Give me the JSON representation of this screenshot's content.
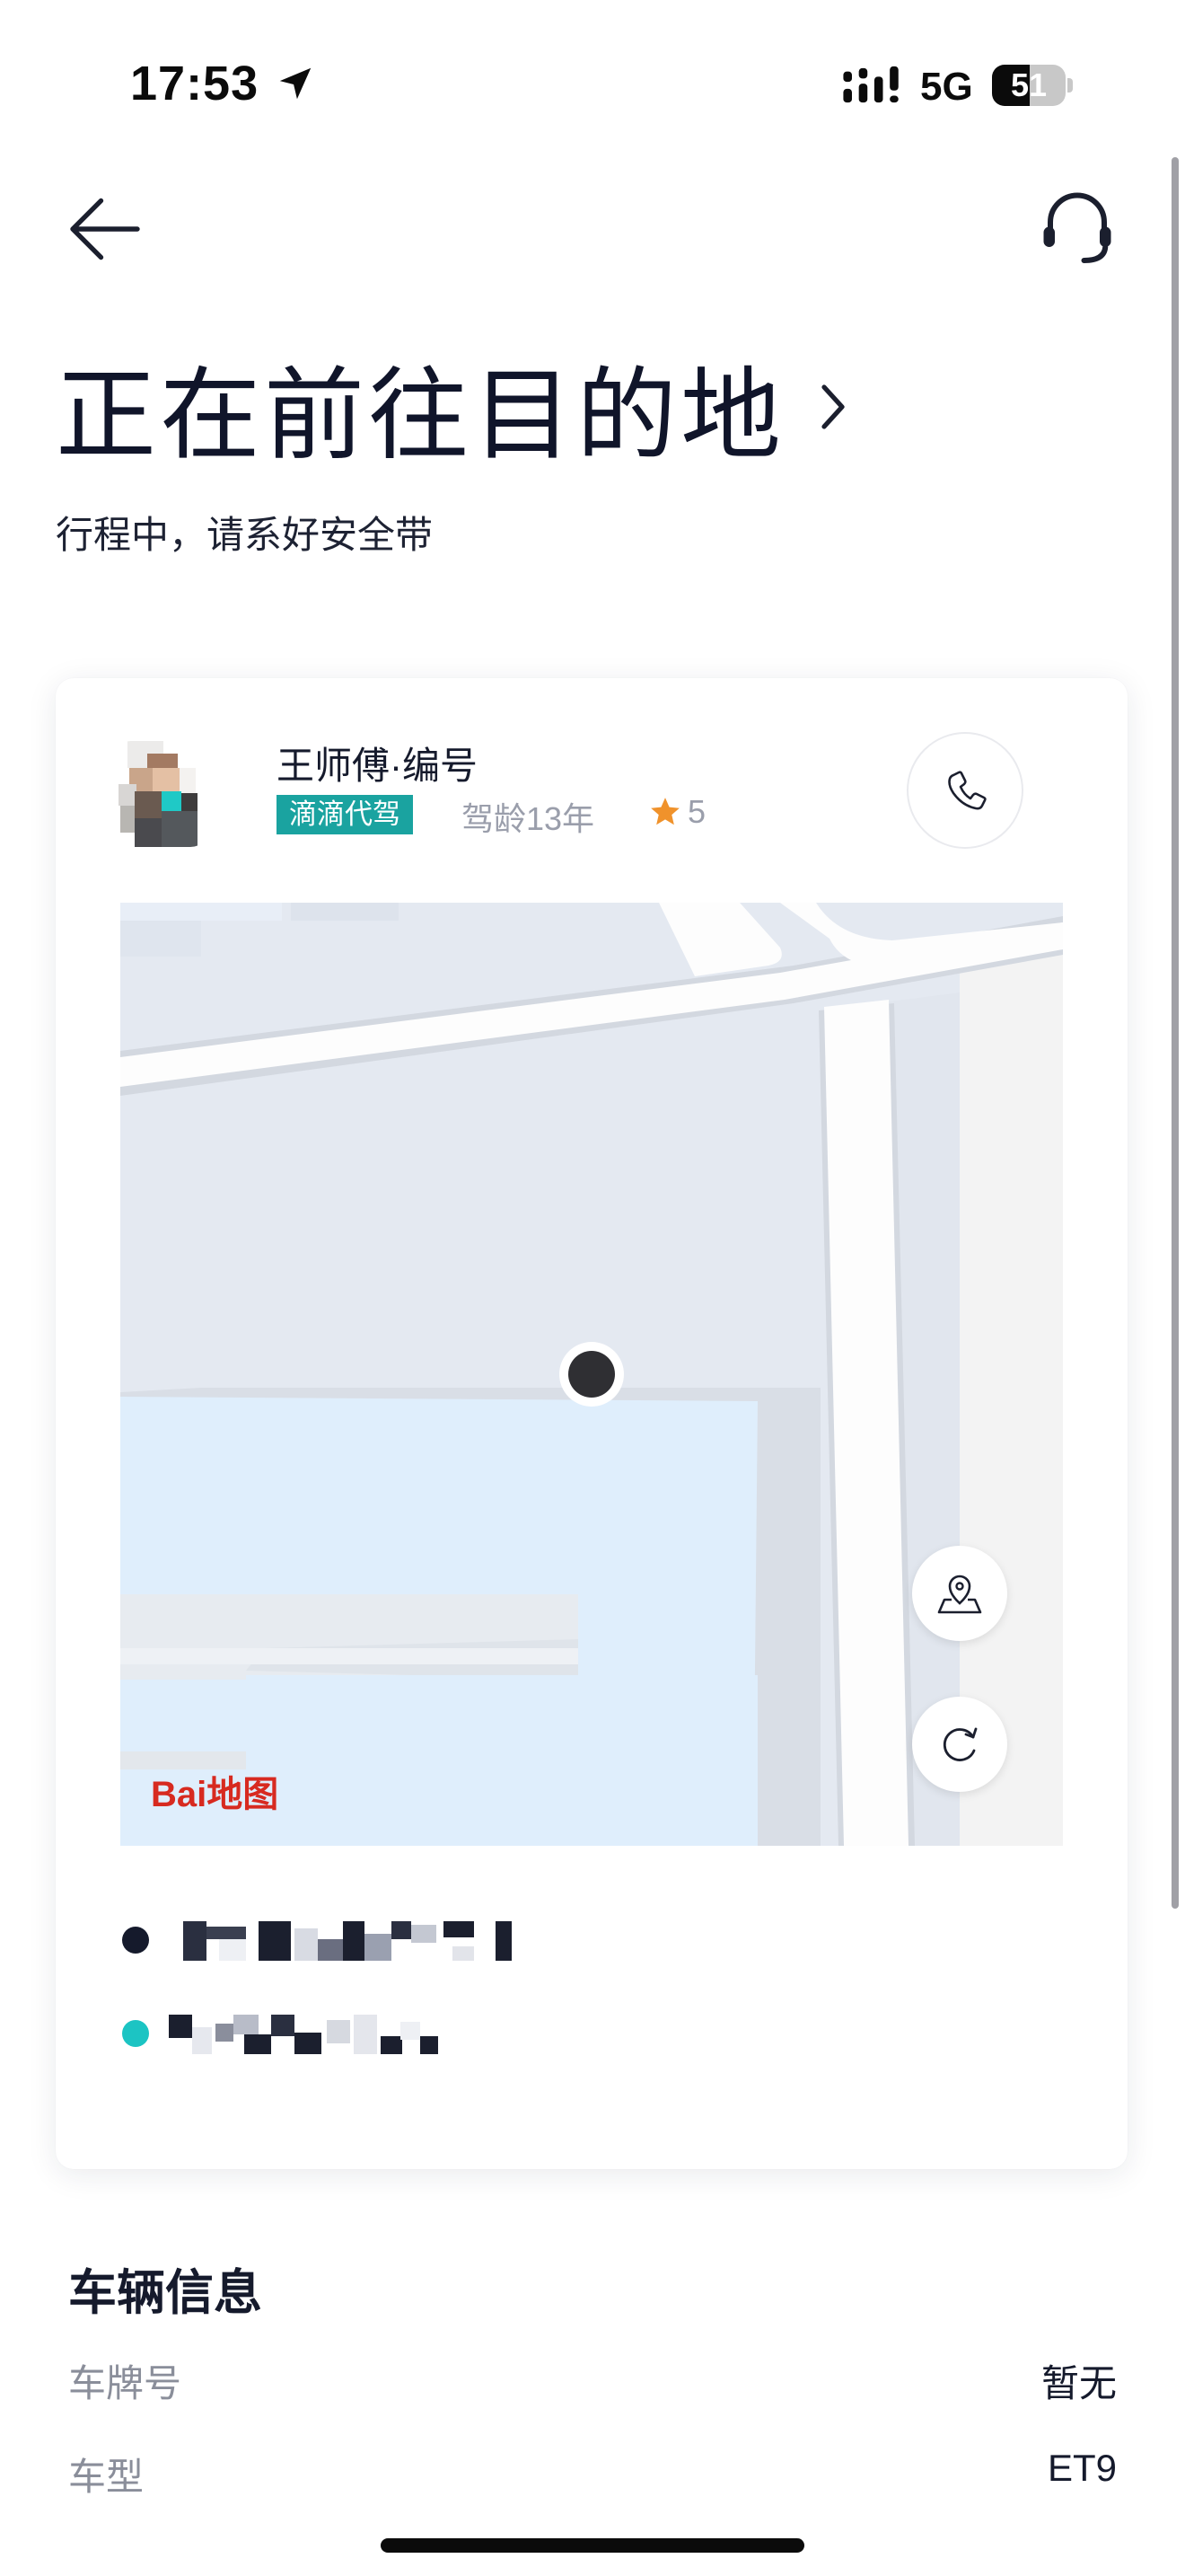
{
  "status_bar": {
    "time": "17:53",
    "network": "5G",
    "battery": "51"
  },
  "header": {
    "title": "正在前往目的地",
    "subtitle": "行程中，请系好安全带"
  },
  "driver": {
    "name": "王师傅·编号",
    "tag": "滴滴代驾",
    "experience": "驾龄13年",
    "rating": "5"
  },
  "map": {
    "logo": "Bai地图"
  },
  "vehicle": {
    "section_title": "车辆信息",
    "rows": [
      {
        "label": "车牌号",
        "value": "暂无"
      },
      {
        "label": "车型",
        "value": "ET9"
      }
    ]
  },
  "colors": {
    "accent": "#1aa3a0",
    "star": "#f0922b",
    "text_primary": "#151a2c",
    "text_secondary": "#8a8e9a"
  }
}
